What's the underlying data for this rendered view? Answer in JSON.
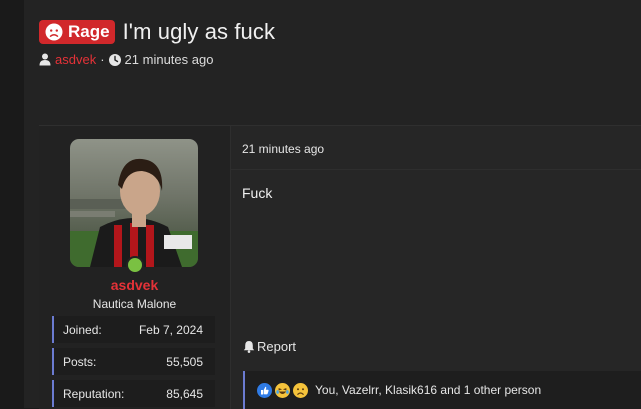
{
  "thread": {
    "prefix": "Rage",
    "title": "I'm ugly as fuck",
    "author": "asdvek",
    "separator": "·",
    "time": "21 minutes ago"
  },
  "user": {
    "name": "asdvek",
    "title": "Nautica Malone",
    "online": true,
    "stats": [
      {
        "label": "Joined:",
        "value": "Feb 7, 2024"
      },
      {
        "label": "Posts:",
        "value": "55,505"
      },
      {
        "label": "Reputation:",
        "value": "85,645"
      }
    ]
  },
  "post": {
    "time": "21 minutes ago",
    "body": "Fuck",
    "report_label": "Report",
    "reactions": {
      "icons": [
        "like-icon",
        "laugh-icon",
        "sad-icon"
      ],
      "summary": "You, Vazelrr, Klasik616 and 1 other person"
    }
  },
  "colors": {
    "accent": "#d1282b",
    "username": "#e53238",
    "online": "#7ac142",
    "bar": "#6b7bd1"
  }
}
